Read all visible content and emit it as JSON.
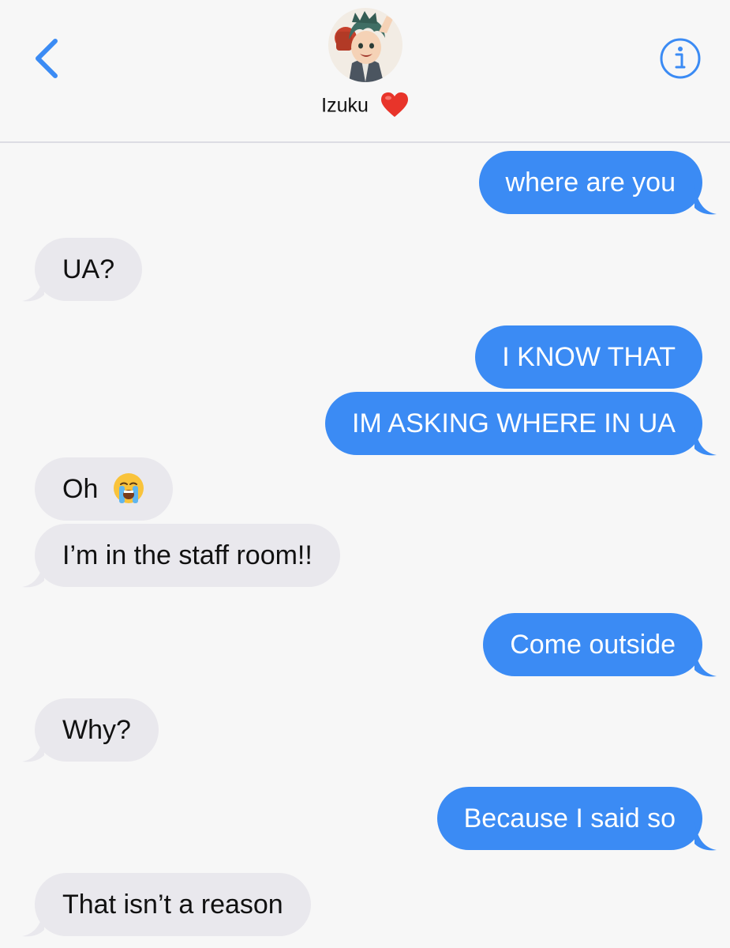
{
  "header": {
    "contact_name": "Izuku",
    "heart_emoji": "❤️",
    "back_icon": "chevron-left-icon",
    "info_icon": "info-circle-icon",
    "accent_color": "#3b8bf4"
  },
  "messages": [
    {
      "direction": "sent",
      "text": "where are you"
    },
    {
      "direction": "received",
      "text": "UA?"
    },
    {
      "direction": "sent",
      "text": "I KNOW THAT"
    },
    {
      "direction": "sent",
      "text": "IM ASKING WHERE IN UA"
    },
    {
      "direction": "received",
      "text": "Oh",
      "emoji": "😭"
    },
    {
      "direction": "received",
      "text": "I’m in the staff room!!"
    },
    {
      "direction": "sent",
      "text": "Come outside"
    },
    {
      "direction": "received",
      "text": "Why?"
    },
    {
      "direction": "sent",
      "text": "Because I said so"
    },
    {
      "direction": "received",
      "text": "That isn’t a reason"
    }
  ],
  "colors": {
    "sent_bubble": "#3b8bf4",
    "received_bubble": "#e9e8ed",
    "background": "#f7f7f7"
  }
}
